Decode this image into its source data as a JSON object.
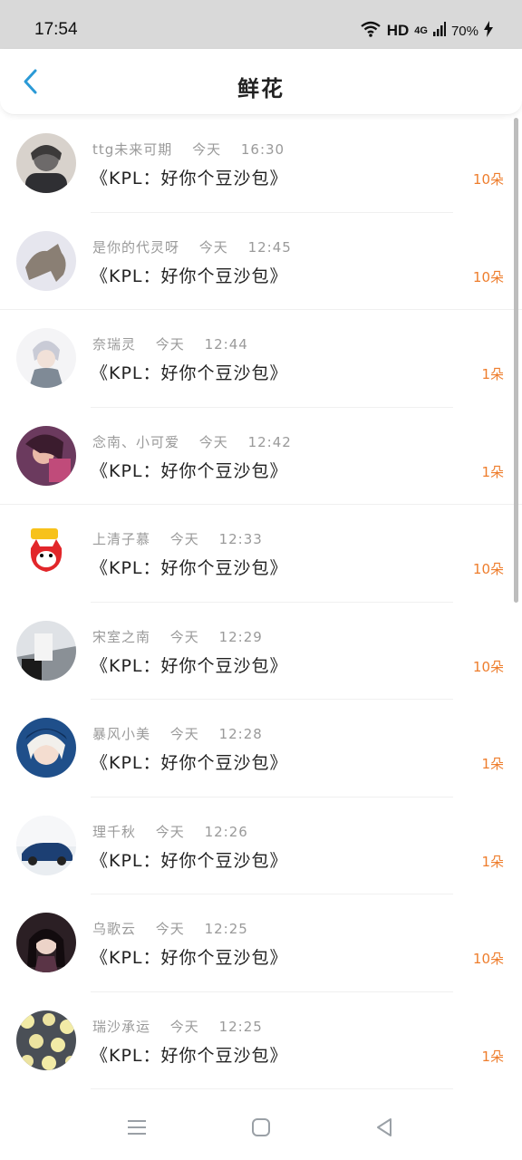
{
  "status_bar": {
    "time": "17:54",
    "hd": "HD",
    "network_top": "4G",
    "battery": "70%",
    "icons": [
      "wifi-icon",
      "signal-icon",
      "battery-charging-icon"
    ]
  },
  "header": {
    "title": "鲜花",
    "back_icon": "chevron-left-icon",
    "accent_color": "#2b9ad6"
  },
  "list": {
    "count_color": "#ee7d2c",
    "items": [
      {
        "user": "ttg未来可期",
        "date": "今天",
        "time": "16:30",
        "gift": "《KPL：好你个豆沙包》",
        "count": "10朵"
      },
      {
        "user": "是你的代灵呀",
        "date": "今天",
        "time": "12:45",
        "gift": "《KPL：好你个豆沙包》",
        "count": "10朵"
      },
      {
        "user": "奈瑞灵",
        "date": "今天",
        "time": "12:44",
        "gift": "《KPL：好你个豆沙包》",
        "count": "1朵"
      },
      {
        "user": "念南、小可爱",
        "date": "今天",
        "time": "12:42",
        "gift": "《KPL：好你个豆沙包》",
        "count": "1朵"
      },
      {
        "user": "上清子慕",
        "date": "今天",
        "time": "12:33",
        "gift": "《KPL：好你个豆沙包》",
        "count": "10朵"
      },
      {
        "user": "宋室之南",
        "date": "今天",
        "time": "12:29",
        "gift": "《KPL：好你个豆沙包》",
        "count": "10朵"
      },
      {
        "user": "暴风小美",
        "date": "今天",
        "time": "12:28",
        "gift": "《KPL：好你个豆沙包》",
        "count": "1朵"
      },
      {
        "user": "理千秋",
        "date": "今天",
        "time": "12:26",
        "gift": "《KPL：好你个豆沙包》",
        "count": "1朵"
      },
      {
        "user": "乌歌云",
        "date": "今天",
        "time": "12:25",
        "gift": "《KPL：好你个豆沙包》",
        "count": "10朵"
      },
      {
        "user": "瑞沙承运",
        "date": "今天",
        "time": "12:25",
        "gift": "《KPL：好你个豆沙包》",
        "count": "1朵"
      }
    ]
  },
  "bottom_nav": {
    "icons": [
      "menu-icon",
      "home-square-icon",
      "back-triangle-icon"
    ]
  }
}
